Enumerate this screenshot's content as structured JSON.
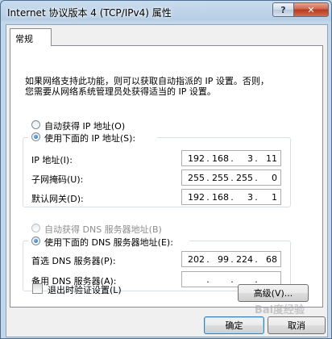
{
  "window": {
    "title": "Internet 协议版本 4 (TCP/IPv4) 属性",
    "help_label": "?",
    "close_label": "✕"
  },
  "tab": {
    "label": "常规"
  },
  "description": {
    "line1": "如果网络支持此功能，则可以获取自动指派的 IP 设置。否则，",
    "line2": "您需要从网络系统管理员处获得适当的 IP 设置。"
  },
  "ip": {
    "auto_label": "自动获得 IP 地址(O)",
    "manual_label": "使用下面的 IP 地址(S):",
    "mode": "manual",
    "fields": [
      {
        "label": "IP 地址(I):",
        "value": [
          "192",
          "168",
          "3",
          "11"
        ]
      },
      {
        "label": "子网掩码(U):",
        "value": [
          "255",
          "255",
          "255",
          "0"
        ]
      },
      {
        "label": "默认网关(D):",
        "value": [
          "192",
          "168",
          "3",
          "1"
        ]
      }
    ]
  },
  "dns": {
    "auto_label": "自动获得 DNS 服务器地址(B)",
    "manual_label": "使用下面的 DNS 服务器地址(E):",
    "mode": "manual",
    "fields": [
      {
        "label": "首选 DNS 服务器(P):",
        "value": [
          "202",
          "99",
          "224",
          "68"
        ]
      },
      {
        "label": "备用 DNS 服务器(A):",
        "value": [
          "",
          "",
          "",
          ""
        ]
      }
    ]
  },
  "validate": {
    "label": "退出时验证设置(L)",
    "checked": false
  },
  "buttons": {
    "advanced": "高级(V)...",
    "ok": "确定",
    "cancel": "取消"
  },
  "watermark": "Bai度经验"
}
